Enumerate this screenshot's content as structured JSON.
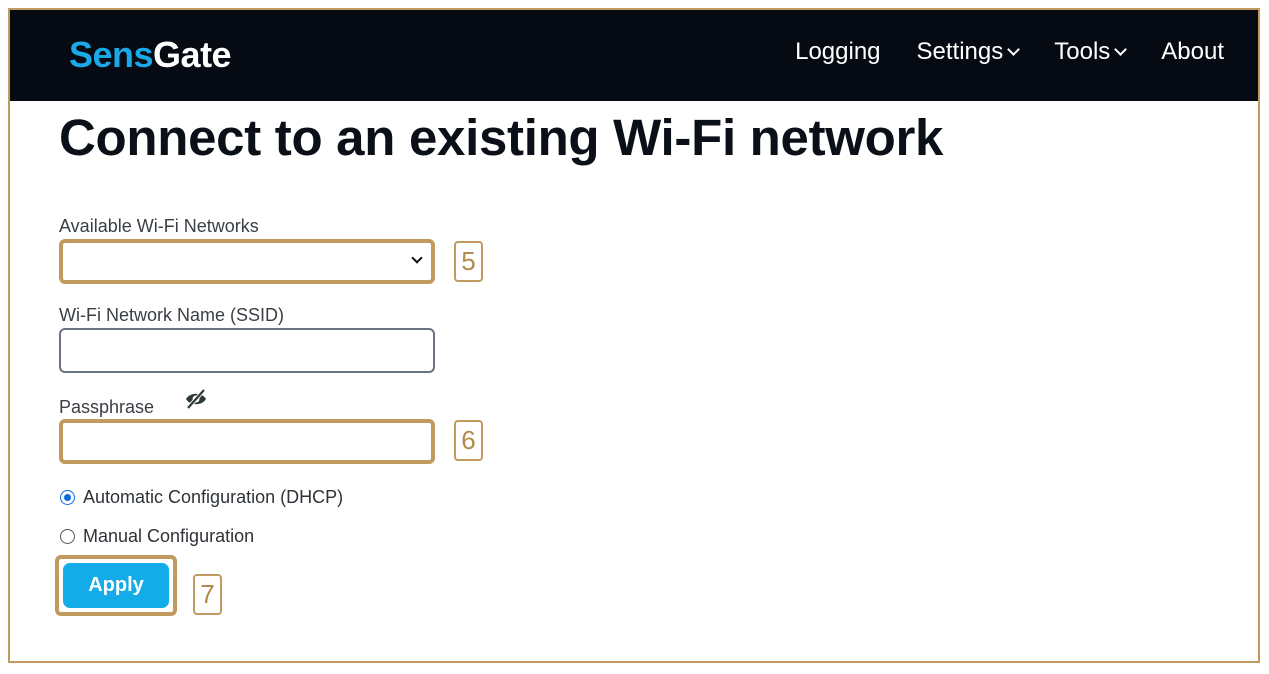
{
  "navbar": {
    "brand_part1": "Sens",
    "brand_part2": "Gate",
    "items": [
      {
        "label": "Logging",
        "has_dropdown": false
      },
      {
        "label": "Settings",
        "has_dropdown": true
      },
      {
        "label": "Tools",
        "has_dropdown": true
      },
      {
        "label": "About",
        "has_dropdown": false
      }
    ]
  },
  "page": {
    "title": "Connect to an existing Wi-Fi network"
  },
  "form": {
    "networks_label": "Available Wi-Fi Networks",
    "networks_selected": "",
    "ssid_label": "Wi-Fi Network Name (SSID)",
    "ssid_value": "",
    "passphrase_label": "Passphrase",
    "passphrase_value": "",
    "passphrase_toggle_icon": "eye-slash-icon",
    "radio_dhcp_label": "Automatic Configuration (DHCP)",
    "radio_dhcp_checked": true,
    "radio_manual_label": "Manual Configuration",
    "radio_manual_checked": false,
    "apply_label": "Apply"
  },
  "annotations": {
    "badge_networks": "5",
    "badge_passphrase": "6",
    "badge_apply": "7",
    "highlight_color": "#c09a5e"
  },
  "colors": {
    "navbar_bg": "#060b13",
    "brand_accent": "#1aa9e6",
    "button_bg": "#14ace8"
  }
}
